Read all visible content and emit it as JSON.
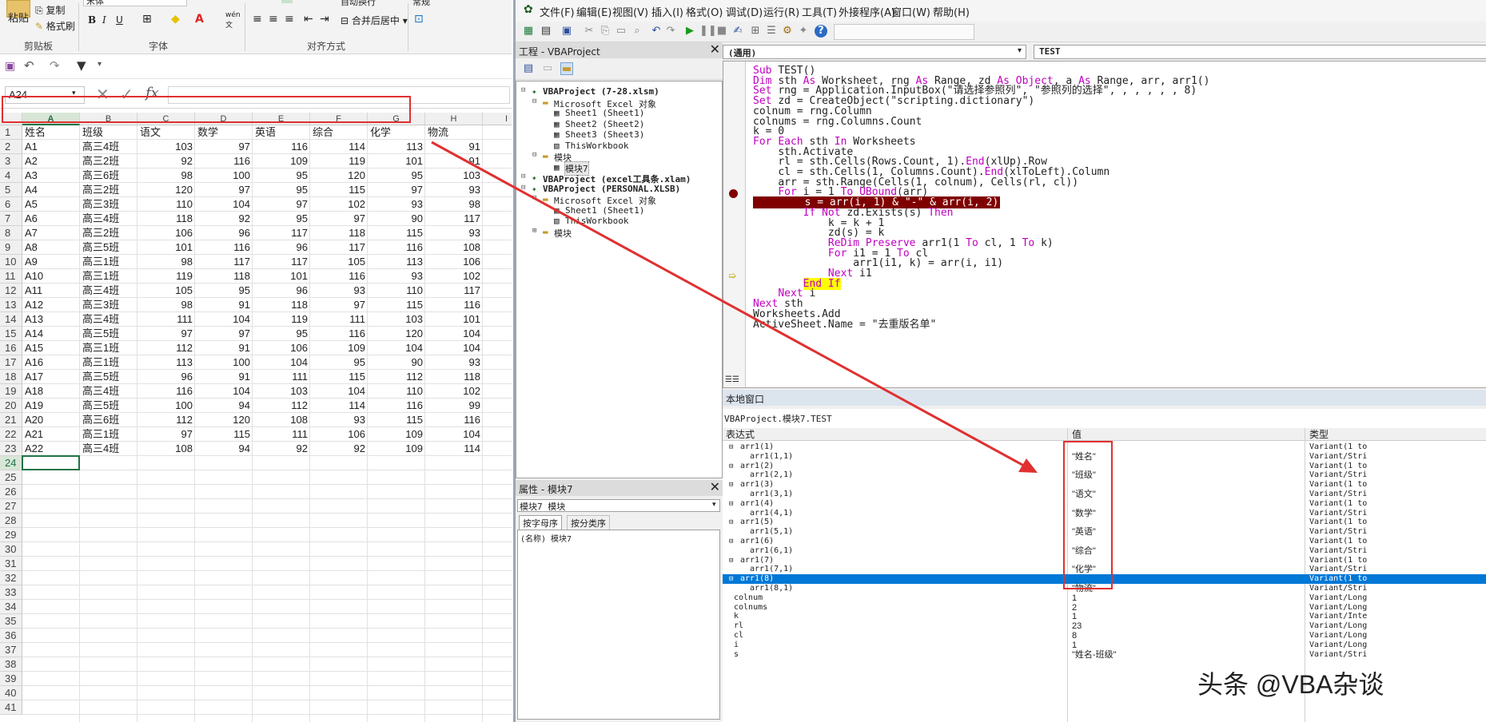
{
  "excel": {
    "ribbon": {
      "paste": "粘贴",
      "copy": "复制",
      "format_painter": "格式刷",
      "clipboard_group": "剪贴板",
      "font_group": "字体",
      "align_group": "对齐方式",
      "font_name": "宋体",
      "bold": "B",
      "italic": "I",
      "underline": "U",
      "merge_center": "合并后居中",
      "wrap_text": "自动换行",
      "number_format": "常规"
    },
    "name_box": "A24",
    "formula_fx": "fx",
    "columns": [
      "A",
      "B",
      "C",
      "D",
      "E",
      "F",
      "G",
      "H",
      "I"
    ],
    "rows": [
      [
        "姓名",
        "班级",
        "语文",
        "数学",
        "英语",
        "综合",
        "化学",
        "物流"
      ],
      [
        "A1",
        "高三4班",
        "103",
        "97",
        "116",
        "114",
        "113",
        "91"
      ],
      [
        "A2",
        "高三2班",
        "92",
        "116",
        "109",
        "119",
        "101",
        "91"
      ],
      [
        "A3",
        "高三6班",
        "98",
        "100",
        "95",
        "120",
        "95",
        "103"
      ],
      [
        "A4",
        "高三2班",
        "120",
        "97",
        "95",
        "115",
        "97",
        "93"
      ],
      [
        "A5",
        "高三3班",
        "110",
        "104",
        "97",
        "102",
        "93",
        "98"
      ],
      [
        "A6",
        "高三4班",
        "118",
        "92",
        "95",
        "97",
        "90",
        "117"
      ],
      [
        "A7",
        "高三2班",
        "106",
        "96",
        "117",
        "118",
        "115",
        "93"
      ],
      [
        "A8",
        "高三5班",
        "101",
        "116",
        "96",
        "117",
        "116",
        "108"
      ],
      [
        "A9",
        "高三1班",
        "98",
        "117",
        "117",
        "105",
        "113",
        "106"
      ],
      [
        "A10",
        "高三1班",
        "119",
        "118",
        "101",
        "116",
        "93",
        "102"
      ],
      [
        "A11",
        "高三4班",
        "105",
        "95",
        "96",
        "93",
        "110",
        "117"
      ],
      [
        "A12",
        "高三3班",
        "98",
        "91",
        "118",
        "97",
        "115",
        "116"
      ],
      [
        "A13",
        "高三4班",
        "111",
        "104",
        "119",
        "111",
        "103",
        "101"
      ],
      [
        "A14",
        "高三5班",
        "97",
        "97",
        "95",
        "116",
        "120",
        "104"
      ],
      [
        "A15",
        "高三1班",
        "112",
        "91",
        "106",
        "109",
        "104",
        "104"
      ],
      [
        "A16",
        "高三1班",
        "113",
        "100",
        "104",
        "95",
        "90",
        "93"
      ],
      [
        "A17",
        "高三5班",
        "96",
        "91",
        "111",
        "115",
        "112",
        "118"
      ],
      [
        "A18",
        "高三4班",
        "116",
        "104",
        "103",
        "104",
        "110",
        "102"
      ],
      [
        "A19",
        "高三5班",
        "100",
        "94",
        "112",
        "114",
        "116",
        "99"
      ],
      [
        "A20",
        "高三6班",
        "112",
        "120",
        "108",
        "93",
        "115",
        "116"
      ],
      [
        "A21",
        "高三1班",
        "97",
        "115",
        "111",
        "106",
        "109",
        "104"
      ],
      [
        "A22",
        "高三4班",
        "108",
        "94",
        "92",
        "92",
        "109",
        "114"
      ]
    ],
    "row_numbers": [
      "1",
      "2",
      "3",
      "4",
      "5",
      "6",
      "7",
      "8",
      "9",
      "10",
      "11",
      "12",
      "13",
      "14",
      "15",
      "16",
      "17",
      "18",
      "19",
      "20",
      "21",
      "22",
      "23",
      "24",
      "25",
      "26",
      "27",
      "28",
      "29",
      "30",
      "31",
      "32",
      "33",
      "34",
      "35",
      "36",
      "37",
      "38",
      "39",
      "40",
      "41"
    ]
  },
  "vbe": {
    "menus": [
      "文件(F)",
      "编辑(E)",
      "视图(V)",
      "插入(I)",
      "格式(O)",
      "调试(D)",
      "运行(R)",
      "工具(T)",
      "外接程序(A)",
      "窗口(W)",
      "帮助(H)"
    ],
    "project_title": "工程 - VBAProject",
    "project_tree": [
      {
        "label": "VBAProject (7-28.xlsm)",
        "indent": 0,
        "bold": true
      },
      {
        "label": "Microsoft Excel 对象",
        "indent": 1,
        "bold": false
      },
      {
        "label": "Sheet1 (Sheet1)",
        "indent": 2,
        "bold": false
      },
      {
        "label": "Sheet2 (Sheet2)",
        "indent": 2,
        "bold": false
      },
      {
        "label": "Sheet3 (Sheet3)",
        "indent": 2,
        "bold": false
      },
      {
        "label": "ThisWorkbook",
        "indent": 2,
        "bold": false
      },
      {
        "label": "模块",
        "indent": 1,
        "bold": false
      },
      {
        "label": "模块7",
        "indent": 2,
        "bold": false
      },
      {
        "label": "VBAProject (excel工具条.xlam)",
        "indent": 0,
        "bold": true
      },
      {
        "label": "VBAProject (PERSONAL.XLSB)",
        "indent": 0,
        "bold": true
      },
      {
        "label": "Microsoft Excel 对象",
        "indent": 1,
        "bold": false
      },
      {
        "label": "Sheet1 (Sheet1)",
        "indent": 2,
        "bold": false
      },
      {
        "label": "ThisWorkbook",
        "indent": 2,
        "bold": false
      },
      {
        "label": "模块",
        "indent": 1,
        "bold": false
      }
    ],
    "props_title": "属性 - 模块7",
    "props_object": "模块7 模块",
    "props_tab_alpha": "按字母序",
    "props_tab_cat": "按分类序",
    "props_name_row": "(名称) 模块7",
    "object_combo": "(通用)",
    "proc_combo": "TEST",
    "code_lines": [
      "Sub TEST()",
      "Dim sth As Worksheet, rng As Range, zd As Object, a As Range, arr, arr1()",
      "Set rng = Application.InputBox(\"请选择参照列\", \"参照列的选择\", , , , , , 8)",
      "Set zd = CreateObject(\"scripting.dictionary\")",
      "colnum = rng.Column",
      "colnums = rng.Columns.Count",
      "k = 0",
      "For Each sth In Worksheets",
      "    sth.Activate",
      "    rl = sth.Cells(Rows.Count, 1).End(xlUp).Row",
      "    cl = sth.Cells(1, Columns.Count).End(xlToLeft).Column",
      "    arr = sth.Range(Cells(1, colnum), Cells(rl, cl))",
      "    For i = 1 To UBound(arr)",
      "        s = arr(i, 1) & \"-\" & arr(i, 2)",
      "        If Not zd.Exists(s) Then",
      "            k = k + 1",
      "            zd(s) = k",
      "            ReDim Preserve arr1(1 To cl, 1 To k)",
      "            For i1 = 1 To cl",
      "                arr1(i1, k) = arr(i, i1)",
      "            Next i1",
      "        End If",
      "    Next i",
      "Next sth",
      "Worksheets.Add",
      "ActiveSheet.Name = \"去重版名单\""
    ],
    "locals_title": "本地窗口",
    "locals_context": "VBAProject.模块7.TEST",
    "locals_headers": [
      "表达式",
      "值",
      "类型"
    ],
    "locals_rows": [
      [
        "arr1(1)",
        "",
        "Variant(1 to"
      ],
      [
        "arr1(1,1)",
        "\"姓名\"",
        "Variant/Stri"
      ],
      [
        "arr1(2)",
        "",
        "Variant(1 to"
      ],
      [
        "arr1(2,1)",
        "\"班级\"",
        "Variant/Stri"
      ],
      [
        "arr1(3)",
        "",
        "Variant(1 to"
      ],
      [
        "arr1(3,1)",
        "\"语文\"",
        "Variant/Stri"
      ],
      [
        "arr1(4)",
        "",
        "Variant(1 to"
      ],
      [
        "arr1(4,1)",
        "\"数学\"",
        "Variant/Stri"
      ],
      [
        "arr1(5)",
        "",
        "Variant(1 to"
      ],
      [
        "arr1(5,1)",
        "\"英语\"",
        "Variant/Stri"
      ],
      [
        "arr1(6)",
        "",
        "Variant(1 to"
      ],
      [
        "arr1(6,1)",
        "\"综合\"",
        "Variant/Stri"
      ],
      [
        "arr1(7)",
        "",
        "Variant(1 to"
      ],
      [
        "arr1(7,1)",
        "\"化学\"",
        "Variant/Stri"
      ],
      [
        "arr1(8)",
        "",
        "Variant(1 to"
      ],
      [
        "arr1(8,1)",
        "\"物流\"",
        "Variant/Stri"
      ],
      [
        "colnum",
        "1",
        "Variant/Long"
      ],
      [
        "colnums",
        "2",
        "Variant/Long"
      ],
      [
        "k",
        "1",
        "Variant/Inte"
      ],
      [
        "rl",
        "23",
        "Variant/Long"
      ],
      [
        "cl",
        "8",
        "Variant/Long"
      ],
      [
        "i",
        "1",
        "Variant/Long"
      ],
      [
        "s",
        "\"姓名-班级\"",
        "Variant/Stri"
      ]
    ]
  },
  "watermark": "头条 @VBA杂谈",
  "colors": {
    "highlight_red": "#e03030",
    "breakpoint": "#800000",
    "keyword": "#c000c0",
    "select_blue": "#0078d7",
    "excel_green": "#217346"
  }
}
